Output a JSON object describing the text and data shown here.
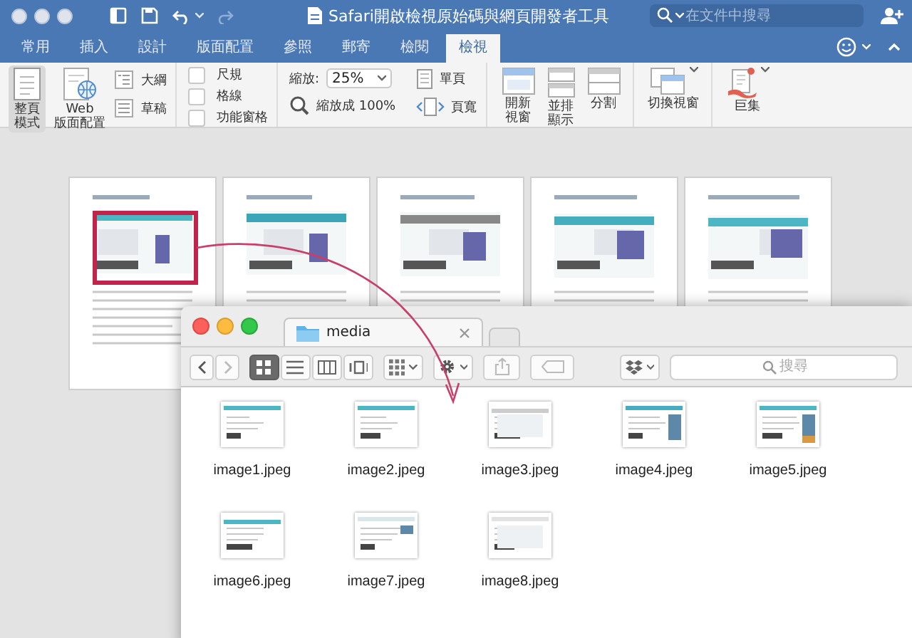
{
  "window": {
    "title": "Safari開啟檢視原始碼與網頁開發者工具"
  },
  "search": {
    "placeholder": "在文件中搜尋"
  },
  "tabs": [
    {
      "label": "常用",
      "selected": false
    },
    {
      "label": "插入",
      "selected": false
    },
    {
      "label": "設計",
      "selected": false
    },
    {
      "label": "版面配置",
      "selected": false
    },
    {
      "label": "參照",
      "selected": false
    },
    {
      "label": "郵寄",
      "selected": false
    },
    {
      "label": "檢閱",
      "selected": false
    },
    {
      "label": "檢視",
      "selected": true
    }
  ],
  "ribbon": {
    "layouts": [
      {
        "label": "整頁模式",
        "kind": "print",
        "selected": true
      },
      {
        "label": "Web\n版面配置",
        "kind": "web",
        "selected": false
      }
    ],
    "views": [
      {
        "label": "大綱",
        "kind": "outline"
      },
      {
        "label": "草稿",
        "kind": "draft"
      }
    ],
    "show": [
      {
        "label": "尺規",
        "checked": false
      },
      {
        "label": "格線",
        "checked": false
      },
      {
        "label": "功能窗格",
        "checked": false
      }
    ],
    "zoom": {
      "label": "縮放:",
      "value": "25%",
      "fit": "縮放成 100%"
    },
    "page_fit": [
      {
        "label": "單頁",
        "kind": "one-page"
      },
      {
        "label": "頁寬",
        "kind": "page-width"
      }
    ],
    "window": [
      {
        "label": "開新視窗",
        "kind": "new-window"
      },
      {
        "label": "並排顯示",
        "kind": "arrange"
      },
      {
        "label": "分割",
        "kind": "split"
      }
    ],
    "switch": {
      "label": "切換視窗"
    },
    "macros": {
      "label": "巨集"
    }
  },
  "pages": [
    {
      "kind": "picture",
      "highlighted": true
    },
    {
      "kind": "picture",
      "highlighted": false
    },
    {
      "kind": "picture",
      "highlighted": false
    },
    {
      "kind": "picture",
      "highlighted": false
    },
    {
      "kind": "picture",
      "highlighted": false
    }
  ],
  "finder": {
    "tab": "media",
    "search_placeholder": "搜尋",
    "view_modes": [
      {
        "kind": "icons",
        "selected": true
      },
      {
        "kind": "list",
        "selected": false
      },
      {
        "kind": "columns",
        "selected": false
      },
      {
        "kind": "coverflow",
        "selected": false
      }
    ],
    "files": [
      {
        "name": "image1.jpeg"
      },
      {
        "name": "image2.jpeg"
      },
      {
        "name": "image3.jpeg"
      },
      {
        "name": "image4.jpeg"
      },
      {
        "name": "image5.jpeg"
      },
      {
        "name": "image6.jpeg"
      },
      {
        "name": "image7.jpeg"
      },
      {
        "name": "image8.jpeg"
      }
    ]
  }
}
